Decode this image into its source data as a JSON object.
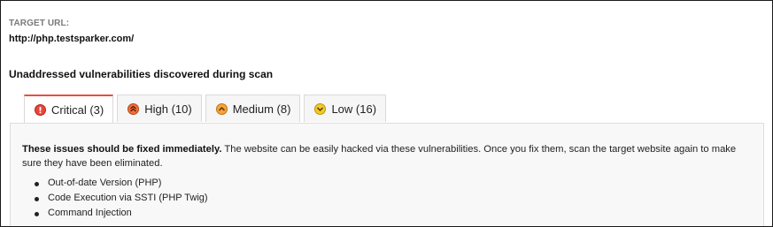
{
  "target": {
    "label": "TARGET URL:",
    "url": "http://php.testsparker.com/"
  },
  "heading": "Unaddressed vulnerabilities discovered during scan",
  "tabs": [
    {
      "label": "Critical (3)",
      "icon": "critical-exclamation-icon",
      "color": "#e8453c",
      "active": true
    },
    {
      "label": "High (10)",
      "icon": "high-double-chevron-icon",
      "color": "#f0703a",
      "active": false
    },
    {
      "label": "Medium (8)",
      "icon": "medium-chevron-up-icon",
      "color": "#f6a43a",
      "active": false
    },
    {
      "label": "Low (16)",
      "icon": "low-chevron-down-icon",
      "color": "#f3c928",
      "active": false
    }
  ],
  "panel": {
    "lead": "These issues should be fixed immediately.",
    "description": " The website can be easily hacked via these vulnerabilities. Once you fix them, scan the target website again to make sure they have been eliminated.",
    "issues": [
      "Out-of-date Version (PHP)",
      "Code Execution via SSTI (PHP Twig)",
      "Command Injection"
    ]
  },
  "colors": {
    "active_tab_accent": "#e4503f"
  }
}
